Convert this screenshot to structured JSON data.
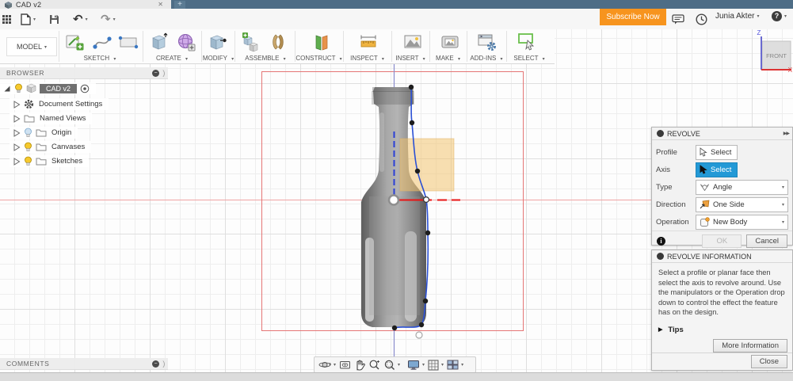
{
  "window": {
    "tab_title": "CAD v2"
  },
  "icons": {
    "caret": "▾",
    "close": "✕",
    "plus": "+",
    "chevrons": "▶▶",
    "bracket": ")",
    "info": "i",
    "undo": "↶",
    "redo": "↷",
    "tips_arrow": "▶",
    "help": "?",
    "dot_small": "●"
  },
  "topbar": {
    "subscribe_label": "Subscribe Now",
    "username": "Junia Akter"
  },
  "ribbon": {
    "workspace_label": "MODEL",
    "groups": [
      {
        "label": "SKETCH"
      },
      {
        "label": "CREATE"
      },
      {
        "label": "MODIFY"
      },
      {
        "label": "ASSEMBLE"
      },
      {
        "label": "CONSTRUCT"
      },
      {
        "label": "INSPECT"
      },
      {
        "label": "INSERT"
      },
      {
        "label": "MAKE"
      },
      {
        "label": "ADD-INS"
      },
      {
        "label": "SELECT"
      }
    ]
  },
  "viewcube": {
    "face": "FRONT",
    "axis_z": "Z",
    "axis_x": "X"
  },
  "browser": {
    "title": "BROWSER",
    "root_label": "CAD v2",
    "items": [
      {
        "label": "Document Settings"
      },
      {
        "label": "Named Views"
      },
      {
        "label": "Origin"
      },
      {
        "label": "Canvases"
      },
      {
        "label": "Sketches"
      }
    ]
  },
  "comments": {
    "title": "COMMENTS"
  },
  "revolve": {
    "title": "REVOLVE",
    "fields": [
      {
        "label": "Profile",
        "value": "Select"
      },
      {
        "label": "Axis",
        "value": "Select"
      },
      {
        "label": "Type",
        "value": "Angle"
      },
      {
        "label": "Direction",
        "value": "One Side"
      },
      {
        "label": "Operation",
        "value": "New Body"
      }
    ],
    "ok_label": "OK",
    "cancel_label": "Cancel"
  },
  "revolve_info": {
    "title": "REVOLVE INFORMATION",
    "body": "Select a profile or planar face then select the axis to revolve around. Use the manipulators or the Operation drop down to control the effect the feature has on the design.",
    "tips_label": "Tips",
    "more_label": "More Information",
    "close_label": "Close"
  },
  "colors": {
    "accent_blue": "#2399d6",
    "subscribe_orange": "#f7941e",
    "axis_red": "#e81515",
    "spline_blue": "#2b50d4",
    "profile_yellow": "#f2c269",
    "tabbar_slate": "#4e6d86"
  }
}
